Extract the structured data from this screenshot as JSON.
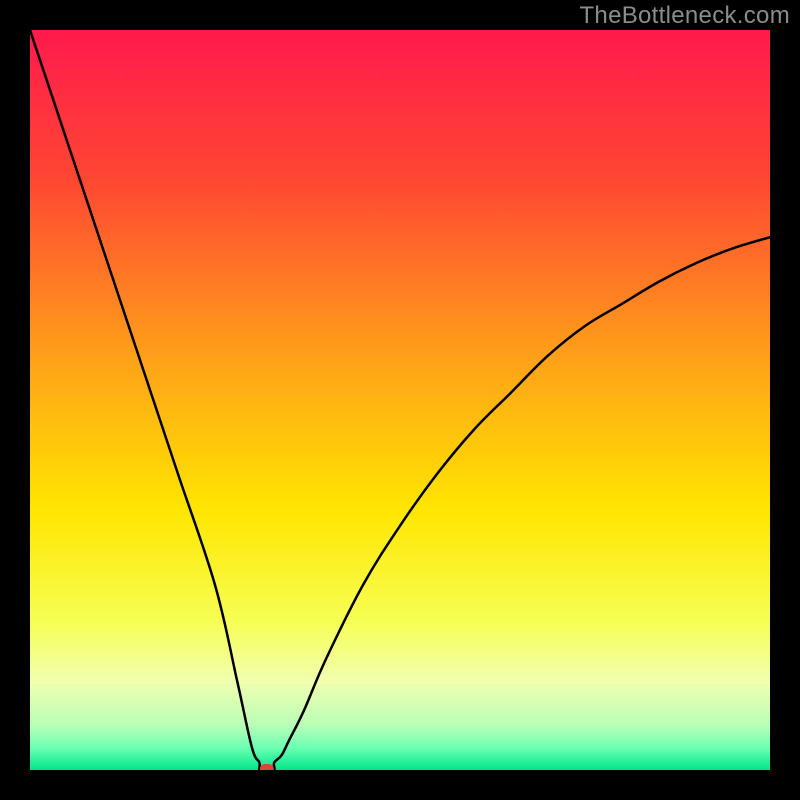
{
  "watermark": "TheBottleneck.com",
  "chart_data": {
    "type": "line",
    "title": "",
    "xlabel": "",
    "ylabel": "",
    "xlim": [
      0,
      100
    ],
    "ylim": [
      0,
      100
    ],
    "grid": false,
    "series": [
      {
        "name": "bottleneck-curve",
        "x": [
          0,
          5,
          10,
          15,
          20,
          25,
          28,
          30,
          31,
          32,
          33,
          34,
          35,
          37,
          40,
          45,
          50,
          55,
          60,
          65,
          70,
          75,
          80,
          85,
          90,
          95,
          100
        ],
        "values": [
          100,
          85,
          70,
          55,
          40,
          25,
          12,
          3,
          1,
          0,
          1,
          2,
          4,
          8,
          15,
          25,
          33,
          40,
          46,
          51,
          56,
          60,
          63,
          66,
          68.5,
          70.5,
          72
        ]
      }
    ],
    "marker": {
      "x": 32,
      "y": 0,
      "color": "#d24a3a"
    },
    "background_gradient": {
      "stops": [
        {
          "pos": 0.0,
          "color": "#ff1a4d"
        },
        {
          "pos": 0.2,
          "color": "#ff4633"
        },
        {
          "pos": 0.45,
          "color": "#ffa318"
        },
        {
          "pos": 0.65,
          "color": "#ffe600"
        },
        {
          "pos": 0.8,
          "color": "#f6ff55"
        },
        {
          "pos": 0.88,
          "color": "#f2ffb0"
        },
        {
          "pos": 0.94,
          "color": "#b7ffb7"
        },
        {
          "pos": 0.97,
          "color": "#6cffb3"
        },
        {
          "pos": 1.0,
          "color": "#00e68a"
        }
      ]
    }
  }
}
